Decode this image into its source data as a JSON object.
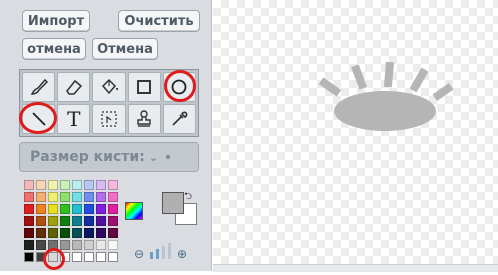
{
  "buttons": {
    "import": "Импорт",
    "clear": "Очистить",
    "undo": "отмена",
    "redo": "Отмена"
  },
  "tools": {
    "row1": [
      "brush-icon",
      "eraser-icon",
      "fill-bucket-icon",
      "rectangle-icon",
      "ellipse-icon"
    ],
    "row2": [
      "line-icon",
      "text-icon",
      "select-icon",
      "stamp-icon",
      "eyedropper-icon"
    ],
    "text_tool_glyph": "T"
  },
  "brush_size": {
    "label": "Размер кисти:"
  },
  "colors": {
    "accent_ring": "#e01b1b",
    "shape_fill": "#b5b5b5",
    "primary": "#b0b0b0",
    "secondary": "#ffffff"
  }
}
